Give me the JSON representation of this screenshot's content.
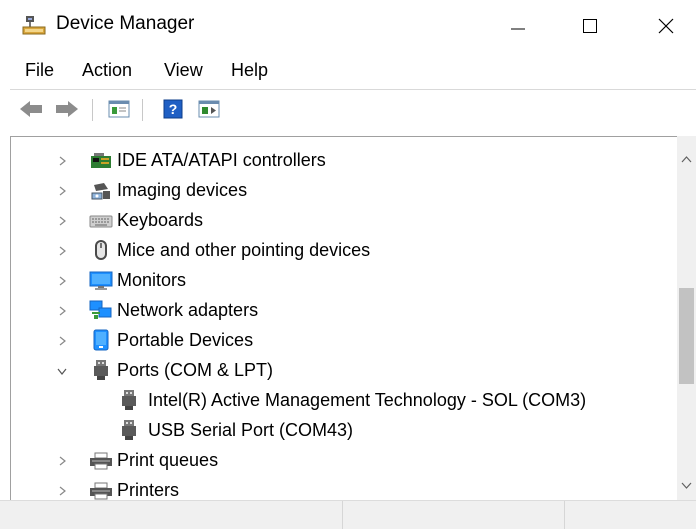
{
  "window": {
    "title": "Device Manager",
    "icon": "device-manager-icon",
    "controls": [
      "minimize-icon",
      "maximize-icon",
      "close-icon"
    ]
  },
  "menu": {
    "file": "File",
    "action": "Action",
    "view": "View",
    "help": "Help"
  },
  "toolbar": {
    "buttons": [
      "back-arrow-icon",
      "forward-arrow-icon",
      "properties-icon",
      "help-icon",
      "update-driver-icon"
    ]
  },
  "tree": {
    "items": [
      {
        "label": "IDE ATA/ATAPI controllers",
        "icon": "ide-controller-icon",
        "expanded": false
      },
      {
        "label": "Imaging devices",
        "icon": "camera-icon",
        "expanded": false
      },
      {
        "label": "Keyboards",
        "icon": "keyboard-icon",
        "expanded": false
      },
      {
        "label": "Mice and other pointing devices",
        "icon": "mouse-icon",
        "expanded": false
      },
      {
        "label": "Monitors",
        "icon": "monitor-icon",
        "expanded": false
      },
      {
        "label": "Network adapters",
        "icon": "network-adapter-icon",
        "expanded": false
      },
      {
        "label": "Portable Devices",
        "icon": "portable-device-icon",
        "expanded": false
      },
      {
        "label": "Ports (COM & LPT)",
        "icon": "port-icon",
        "expanded": true
      },
      {
        "label": "Intel(R) Active Management Technology - SOL (COM3)",
        "icon": "port-icon",
        "child": true
      },
      {
        "label": "USB Serial Port (COM43)",
        "icon": "port-icon",
        "child": true
      },
      {
        "label": "Print queues",
        "icon": "printer-icon",
        "expanded": false
      },
      {
        "label": "Printers",
        "icon": "printer-icon",
        "expanded": false
      }
    ]
  },
  "colors": {
    "accent_blue": "#1e90ff",
    "frame_border": "#a0a0a0",
    "status_bg": "#f0f0f0"
  }
}
